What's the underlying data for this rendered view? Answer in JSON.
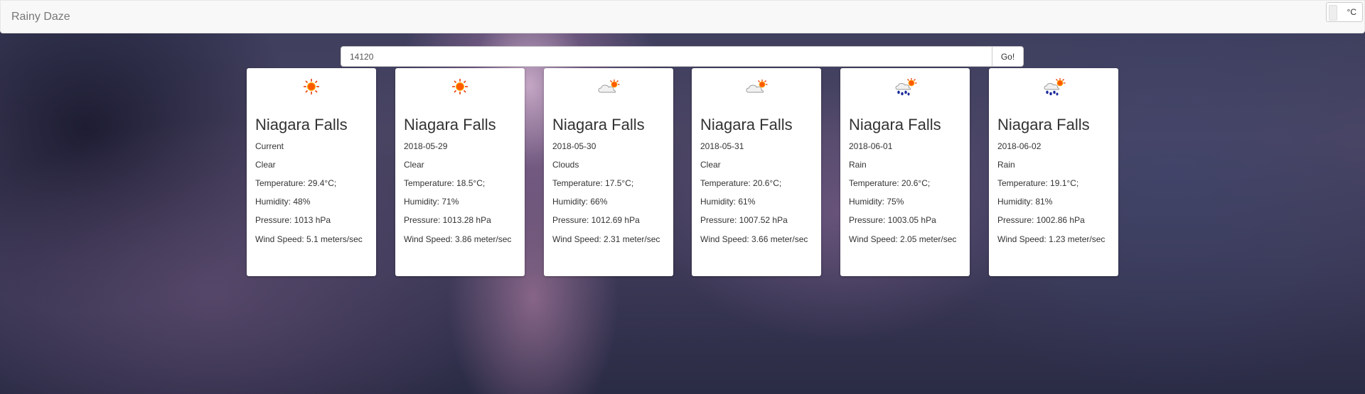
{
  "app": {
    "brand": "Rainy Daze",
    "unit_label": "°C"
  },
  "search": {
    "value": "14120",
    "button_label": "Go!"
  },
  "cards": [
    {
      "city": "Niagara Falls",
      "date": "Current",
      "condition": "Clear",
      "temperature": "Temperature: 29.4°C;",
      "humidity": "Humidity: 48%",
      "pressure": "Pressure: 1013 hPa",
      "wind": "Wind Speed: 5.1 meters/sec",
      "icon": "sun-icon"
    },
    {
      "city": "Niagara Falls",
      "date": "2018-05-29",
      "condition": "Clear",
      "temperature": "Temperature: 18.5°C;",
      "humidity": "Humidity: 71%",
      "pressure": "Pressure: 1013.28 hPa",
      "wind": "Wind Speed: 3.86 meter/sec",
      "icon": "sun-icon"
    },
    {
      "city": "Niagara Falls",
      "date": "2018-05-30",
      "condition": "Clouds",
      "temperature": "Temperature: 17.5°C;",
      "humidity": "Humidity: 66%",
      "pressure": "Pressure: 1012.69 hPa",
      "wind": "Wind Speed: 2.31 meter/sec",
      "icon": "partly-cloudy-icon"
    },
    {
      "city": "Niagara Falls",
      "date": "2018-05-31",
      "condition": "Clear",
      "temperature": "Temperature: 20.6°C;",
      "humidity": "Humidity: 61%",
      "pressure": "Pressure: 1007.52 hPa",
      "wind": "Wind Speed: 3.66 meter/sec",
      "icon": "partly-cloudy-icon"
    },
    {
      "city": "Niagara Falls",
      "date": "2018-06-01",
      "condition": "Rain",
      "temperature": "Temperature: 20.6°C;",
      "humidity": "Humidity: 75%",
      "pressure": "Pressure: 1003.05 hPa",
      "wind": "Wind Speed: 2.05 meter/sec",
      "icon": "rain-sun-icon"
    },
    {
      "city": "Niagara Falls",
      "date": "2018-06-02",
      "condition": "Rain",
      "temperature": "Temperature: 19.1°C;",
      "humidity": "Humidity: 81%",
      "pressure": "Pressure: 1002.86 hPa",
      "wind": "Wind Speed: 1.23 meter/sec",
      "icon": "rain-sun-icon"
    }
  ]
}
